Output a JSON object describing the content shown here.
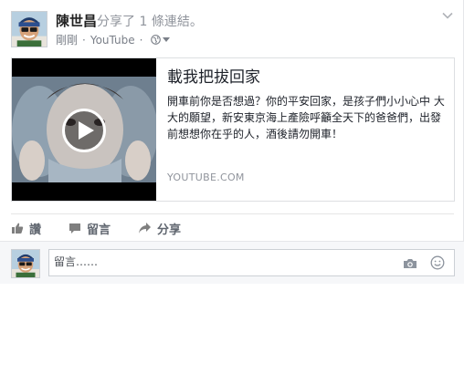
{
  "post": {
    "author": "陳世昌",
    "action": "分享了 1 條連結。",
    "time": "剛剛",
    "source": "YouTube",
    "privacy_icon": "globe-icon"
  },
  "link": {
    "title": "載我把拔回家",
    "description": "開車前你是否想過？你的平安回家，是孩子們小小心中 大大的願望，新安東京海上產險呼籲全天下的爸爸們，出發前想想你在乎的人，酒後請勿開車！",
    "domain": "YOUTUBE.COM"
  },
  "actions": {
    "like": "讚",
    "comment": "留言",
    "share": "分享"
  },
  "comment": {
    "placeholder": "留言……"
  },
  "colors": {
    "secondary_text": "#90949c",
    "border": "#dddfe2",
    "action_text": "#616770"
  }
}
